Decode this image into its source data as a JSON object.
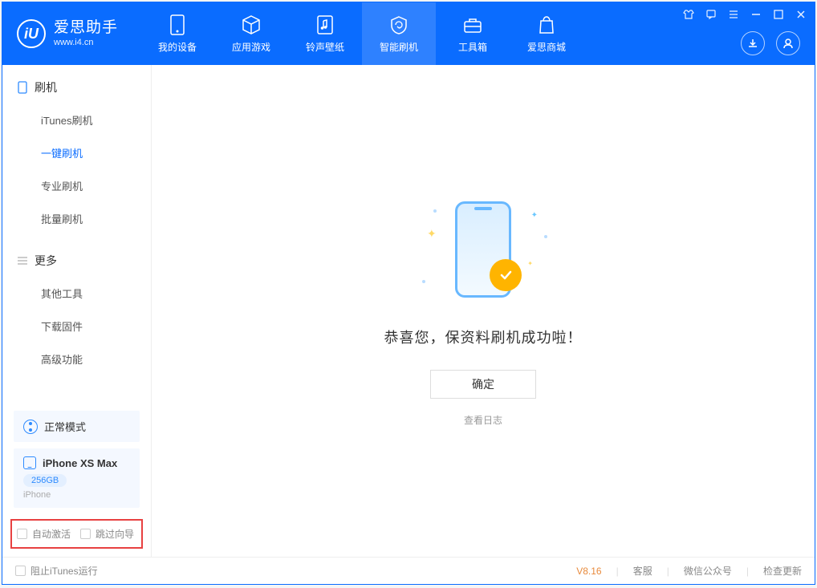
{
  "app": {
    "title": "爱思助手",
    "subtitle": "www.i4.cn"
  },
  "nav": [
    {
      "label": "我的设备",
      "icon": "device"
    },
    {
      "label": "应用游戏",
      "icon": "cube"
    },
    {
      "label": "铃声壁纸",
      "icon": "music"
    },
    {
      "label": "智能刷机",
      "icon": "refresh",
      "active": true
    },
    {
      "label": "工具箱",
      "icon": "toolbox"
    },
    {
      "label": "爱思商城",
      "icon": "bag"
    }
  ],
  "sidebar": {
    "section1": {
      "title": "刷机",
      "items": [
        {
          "label": "iTunes刷机"
        },
        {
          "label": "一键刷机",
          "active": true
        },
        {
          "label": "专业刷机"
        },
        {
          "label": "批量刷机"
        }
      ]
    },
    "section2": {
      "title": "更多",
      "items": [
        {
          "label": "其他工具"
        },
        {
          "label": "下载固件"
        },
        {
          "label": "高级功能"
        }
      ]
    },
    "mode": "正常模式",
    "device": {
      "name": "iPhone XS Max",
      "storage": "256GB",
      "type": "iPhone"
    },
    "options": {
      "auto_activate": "自动激活",
      "skip_guide": "跳过向导"
    }
  },
  "main": {
    "success_text": "恭喜您，保资料刷机成功啦！",
    "ok_button": "确定",
    "log_link": "查看日志"
  },
  "footer": {
    "block_itunes": "阻止iTunes运行",
    "version": "V8.16",
    "links": [
      "客服",
      "微信公众号",
      "检查更新"
    ]
  }
}
